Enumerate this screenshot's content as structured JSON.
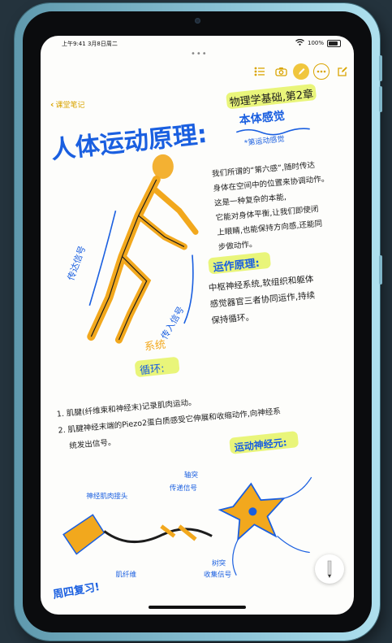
{
  "status_bar": {
    "time": "上午9:41",
    "date": "3月8日周二",
    "battery": "100%"
  },
  "nav": {
    "back_label": "课堂笔记"
  },
  "toolbar": {
    "icons": [
      "checklist-icon",
      "camera-icon",
      "pen-markup-icon",
      "more-icon",
      "compose-icon"
    ]
  },
  "note": {
    "title": "人体运动原理:",
    "subtitle": "物理学基础,第2章",
    "topic": "本体感觉",
    "topic_note": "*第运动感觉",
    "paragraph1": [
      "我们所谓的“第六感”,随时传达",
      "身体在空间中的位置来协调动作。",
      "这是一种复杂的本能,",
      "它能对身体平衡,让我们即使闭",
      "上眼睛,也能保持方向感,还能同",
      "步做动作。"
    ],
    "section_heading": "运作原理:",
    "paragraph2": [
      "中枢神经系统,软组织和躯体",
      "感觉器官三者协同运作,持续",
      "保持循环。"
    ],
    "figure_labels": [
      "传达信号",
      "传入信号"
    ],
    "system_label": "系统",
    "cycle_label": "循环:",
    "steps": [
      "1. 肌腱(纤维束和神经末)记录肌肉运动。",
      "2. 肌腱神经末端的Piezo2蛋白质感受它伸展和收缩动作,向神经系",
      "统发出信号。"
    ],
    "diagram_heading": "运动神经元:",
    "diagram_labels": [
      "神经肌肉接头",
      "轴突",
      "传递信号",
      "树突",
      "收集信号",
      "肌纤维"
    ],
    "review_note": "周四复习!"
  },
  "colors": {
    "ink": "#1c1c1c",
    "blue_ink": "#1a5fe0",
    "orange": "#f2a81d",
    "highlight": "#e9f57a",
    "accent": "#d9a400"
  }
}
